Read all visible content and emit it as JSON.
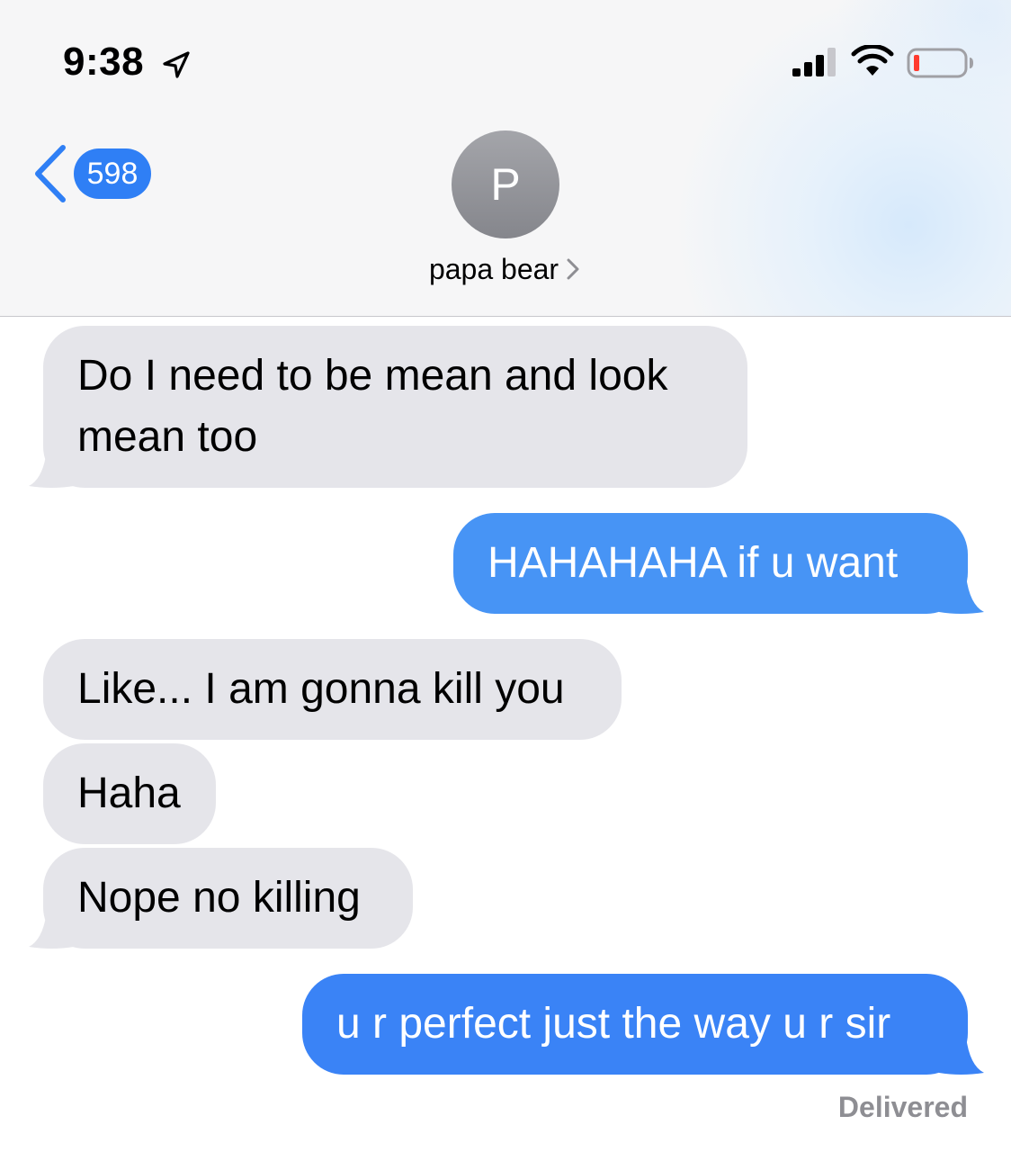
{
  "status_bar": {
    "time": "9:38",
    "icons": [
      "location-arrow-icon",
      "cellular-signal-icon",
      "wifi-icon",
      "battery-low-icon"
    ]
  },
  "nav": {
    "back_badge": "598",
    "avatar_initial": "P",
    "contact_name": "papa bear"
  },
  "messages": [
    {
      "direction": "incoming",
      "lines": [
        "Do I need to be mean and look",
        "mean too"
      ]
    },
    {
      "direction": "outgoing",
      "lines": [
        "HAHAHAHA if u want"
      ]
    },
    {
      "direction": "incoming",
      "lines": [
        "Like... I am gonna kill you"
      ]
    },
    {
      "direction": "incoming",
      "lines": [
        "Haha"
      ]
    },
    {
      "direction": "incoming",
      "lines": [
        "Nope no killing"
      ]
    },
    {
      "direction": "outgoing",
      "lines": [
        "u r perfect just the way u r sir"
      ]
    }
  ],
  "status": {
    "delivered": "Delivered"
  },
  "colors": {
    "incoming_bubble": "#e5e5ea",
    "outgoing_bubble": "#4794f5",
    "accent": "#2f7ff5",
    "battery_low": "#ff3b30"
  }
}
